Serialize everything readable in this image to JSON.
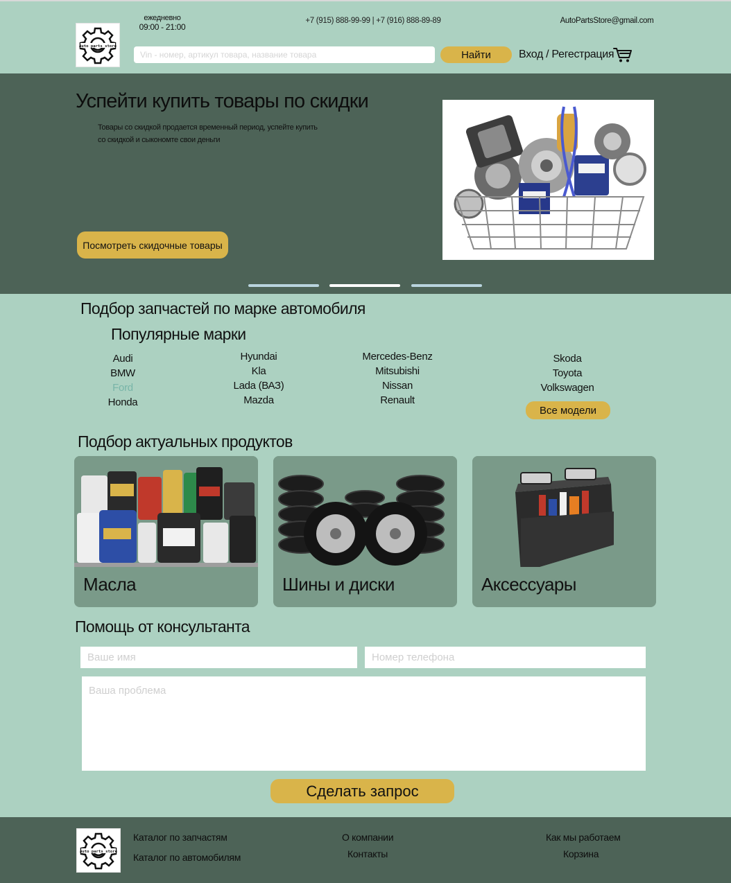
{
  "header": {
    "logo_text": "Auto parts store",
    "hours_label": "ежедневно",
    "hours_value": "09:00 - 21:00",
    "phones": "+7 (915) 888-99-99 | +7 (916) 888-89-89",
    "email": "AutoPartsStore@gmail.com",
    "search_placeholder": "Vin - номер, артикул товара, название товара",
    "search_button": "Найти",
    "login_label": "Вход / Регестрация",
    "cart_icon": "cart-icon"
  },
  "hero": {
    "title": "Успейти купить товары по скидки",
    "description": "Товары со скидкой продается временный период, успейте купить со скидкой и сыкономте свои деньги",
    "button": "Посмотреть скидочные товары",
    "slides_total": 3,
    "active_slide": 2
  },
  "brands": {
    "section_title": "Подбор запчастей по марке автомобиля",
    "subtitle": "Популярные марки",
    "col1": [
      "Audi",
      "BMW",
      "Ford",
      "Honda"
    ],
    "col2": [
      "Hyundai",
      "Kla",
      "Lada (ВАЗ)",
      "Mazda"
    ],
    "col3": [
      "Mercedes-Benz",
      "Mitsubishi",
      "Nissan",
      "Renault"
    ],
    "col4": [
      "Skoda",
      "Toyota",
      "Volkswagen"
    ],
    "highlighted": "Ford",
    "all_models_button": "Все модели"
  },
  "products": {
    "section_title": "Подбор актуальных продуктов",
    "cards": [
      {
        "label": "Масла"
      },
      {
        "label": "Шины и диски"
      },
      {
        "label": "Аксессуары"
      }
    ]
  },
  "consultant": {
    "section_title": "Помощь от консультанта",
    "name_placeholder": "Ваше имя",
    "phone_placeholder": "Номер телефона",
    "problem_placeholder": "Ваша проблема",
    "submit_button": "Сделать запрос"
  },
  "footer": {
    "logo_text": "Auto parts store",
    "links": [
      "Каталог по запчастям",
      "Каталог по автомобилям",
      "О компании",
      "Контакты",
      "Как мы работаем",
      "Корзина"
    ]
  },
  "colors": {
    "background": "#acd1c1",
    "dark_band": "#4d6357",
    "accent": "#d9b44a",
    "card": "#7a9a89",
    "highlight_link": "#78b5a8"
  }
}
